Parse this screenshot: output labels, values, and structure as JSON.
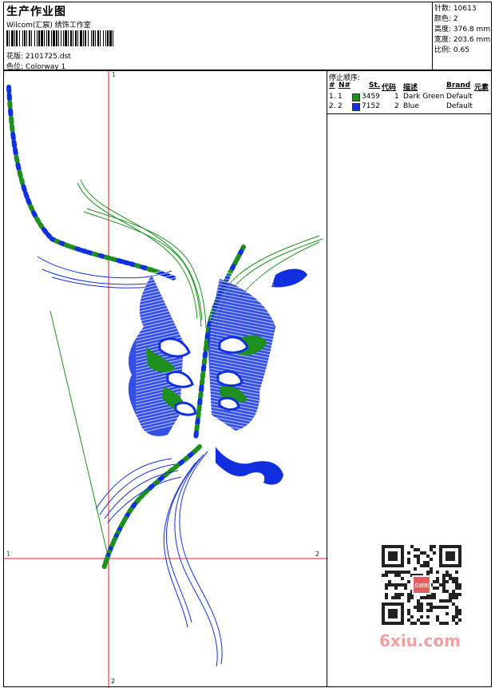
{
  "header": {
    "title": "生产作业图",
    "studio": "Wilcom(汇宸) 绣饰工作室",
    "file_label": "花版:",
    "file_name": "2101725.dst",
    "colorway_label": "色位:",
    "colorway_name": "Colorway 1"
  },
  "specs": {
    "stitches_label": "针数:",
    "stitches": "10613",
    "colors_label": "颜色:",
    "colors": "2",
    "height_label": "高度:",
    "height": "376.8 mm",
    "width_label": "宽度:",
    "width": "203.6 mm",
    "scale_label": "比例:",
    "scale": "0.65"
  },
  "axes": {
    "top_label": "1",
    "bottom_label": "2",
    "left_label": "1",
    "right_label": "2"
  },
  "stop_sequence": {
    "title": "停止顺序:",
    "headers": [
      "#",
      "N#",
      "St.",
      "代码",
      "描述",
      "Brand",
      "元素"
    ],
    "rows": [
      {
        "num": "1.",
        "n": "1",
        "stitches": "3459",
        "code": "1",
        "desc": "Dark Green",
        "brand": "Default",
        "color": "#1e8f1e"
      },
      {
        "num": "2.",
        "n": "2",
        "stitches": "7152",
        "code": "2",
        "desc": "Blue",
        "brand": "Default",
        "color": "#1030e0"
      }
    ]
  },
  "watermark": "6xiu.com",
  "qr_center_text": "拉绣图",
  "colors": {
    "green": "#1e8f1e",
    "blue": "#1030e0",
    "axis_red": "#e02020",
    "watermark": "#f0a2a2"
  }
}
